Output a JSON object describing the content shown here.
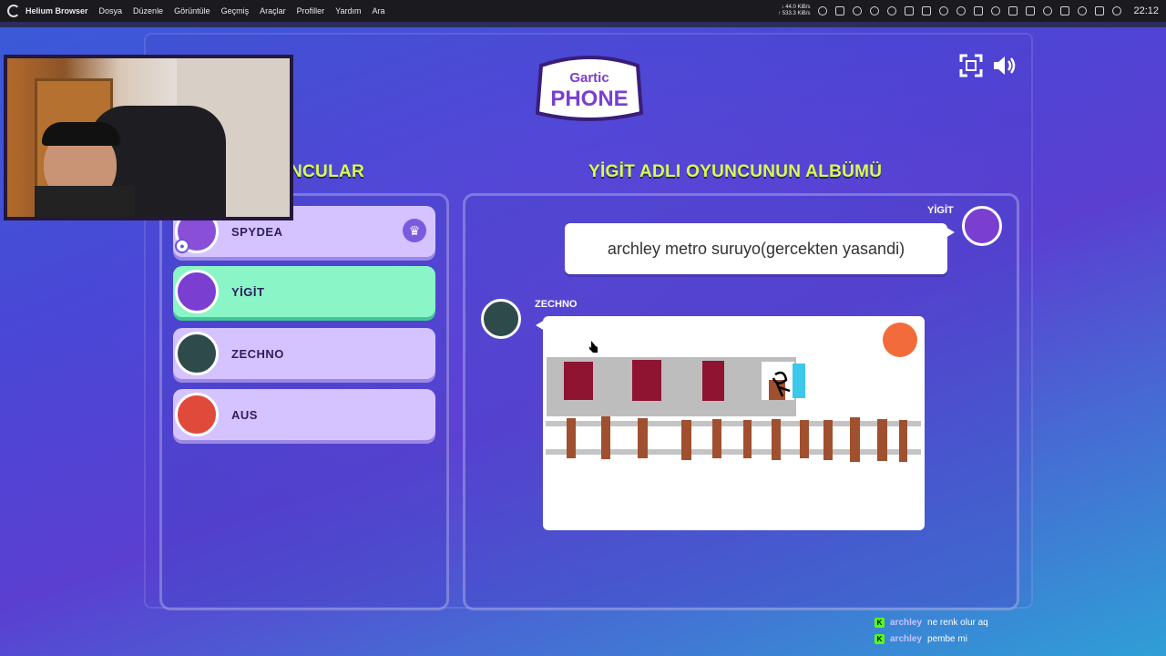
{
  "menubar": {
    "app_name": "Helium Browser",
    "menus": [
      "Dosya",
      "Düzenle",
      "Görüntüle",
      "Geçmiş",
      "Araçlar",
      "Profiller",
      "Yardım",
      "Ara"
    ],
    "net_down": "↓ 44.0 KiB/s",
    "net_up": "↑ 533.3 KiB/s",
    "clock": "22:12"
  },
  "game": {
    "logo_top": "Gartic",
    "logo_bottom": "PHONE",
    "players_title": "NCULAR",
    "album_title": "YİGİT ADLI OYUNCUNUN ALBÜMÜ",
    "players": [
      {
        "name": "SPYDEA",
        "active": false,
        "avatar_color": "#8a4fd8"
      },
      {
        "name": "YİGİT",
        "active": true,
        "avatar_color": "#7a3fd0"
      },
      {
        "name": "ZECHNO",
        "active": false,
        "avatar_color": "#2f4a4a"
      },
      {
        "name": "AUS",
        "active": false,
        "avatar_color": "#e04a3a"
      }
    ],
    "phrase_author": "YİGİT",
    "phrase_text": "archley metro suruyo(gercekten yasandi)",
    "drawing_author": "ZECHNO"
  },
  "chat": [
    {
      "user": "archley",
      "message": "ne renk olur aq"
    },
    {
      "user": "archley",
      "message": "pembe mi"
    }
  ],
  "colors": {
    "accent_title": "#d8ff4a",
    "player_card": "#d4c3ff",
    "player_active": "#8af5c7"
  }
}
